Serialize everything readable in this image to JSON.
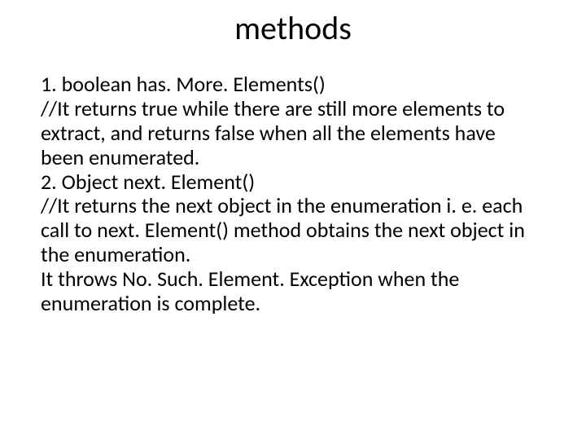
{
  "title": "methods",
  "body_lines": {
    "l1": "1. boolean has. More. Elements()",
    "l2": "//It returns true while there are still more elements to extract, and returns false when all the elements have been enumerated.",
    "l3": "2. Object next. Element()",
    "l4": "//It returns the next object in the enumeration i. e. each call to next. Element() method obtains the next object in the enumeration.",
    "l5": "It throws No. Such. Element. Exception when the enumeration is complete."
  }
}
